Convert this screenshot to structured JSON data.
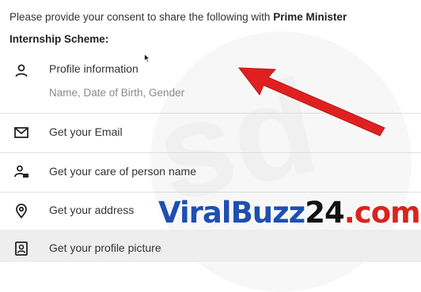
{
  "intro": {
    "text_plain": "Please provide your consent to share the following with ",
    "text_bold_1": "Prime Minister",
    "text_bold_2": "Internship Scheme:"
  },
  "items": [
    {
      "label": "Profile information",
      "sublabel": "Name, Date of Birth, Gender",
      "icon": "person-icon"
    },
    {
      "label": "Get your Email",
      "icon": "email-icon"
    },
    {
      "label": "Get your care of person name",
      "icon": "care-of-person-icon"
    },
    {
      "label": "Get your address",
      "icon": "location-pin-icon"
    },
    {
      "label": "Get your profile picture",
      "icon": "profile-picture-icon"
    }
  ],
  "watermark": {
    "viral": "Viral",
    "buzz": "Buzz",
    "num": "24",
    "dot": ".com"
  },
  "colors": {
    "arrow": "#e02020",
    "watermark_blue": "#1f4fb0",
    "watermark_red": "#d9241c",
    "row_shaded": "#eeeeee"
  }
}
